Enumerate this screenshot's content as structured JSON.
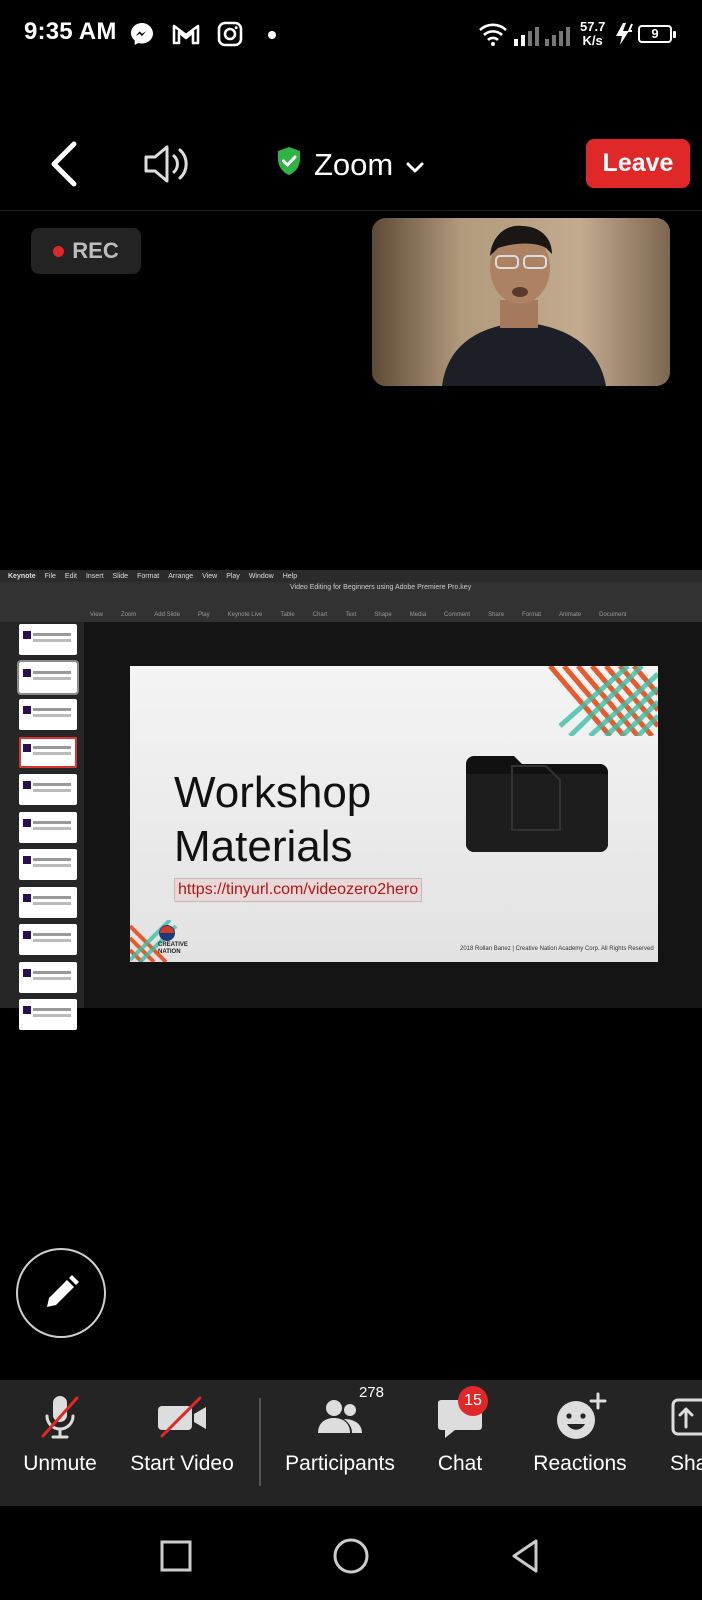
{
  "status_bar": {
    "time": "9:35 AM",
    "net_speed_value": "57.7",
    "net_speed_unit": "K/s",
    "battery": "9",
    "icons": [
      "messenger-icon",
      "gmail-icon",
      "instagram-icon",
      "wifi-icon",
      "signal-icon",
      "charging-icon"
    ]
  },
  "top_bar": {
    "title": "Zoom",
    "leave_label": "Leave"
  },
  "rec_label": "REC",
  "shared_screen": {
    "menubar_items": [
      "Keynote",
      "File",
      "Edit",
      "Insert",
      "Slide",
      "Format",
      "Arrange",
      "View",
      "Play",
      "Window",
      "Help"
    ],
    "document_title": "Video Editing for Beginners using Adobe Premiere Pro.key",
    "toolbar_items": [
      "View",
      "Zoom",
      "Add Slide",
      "Play",
      "Keynote Live",
      "Table",
      "Chart",
      "Text",
      "Shape",
      "Media",
      "Comment",
      "Share",
      "Format",
      "Animate",
      "Document"
    ],
    "slide": {
      "title_line1": "Workshop",
      "title_line2": "Materials",
      "link": "https://tinyurl.com/videozero2hero",
      "logo_line1": "CREATIVE",
      "logo_line2": "NATION",
      "footer": "2018 Rollan Banez | Creative Nation Academy Corp. All Rights Reserved"
    },
    "thumbnail_count": 11
  },
  "toolbar": {
    "unmute_label": "Unmute",
    "start_video_label": "Start Video",
    "participants_label": "Participants",
    "participants_count": "278",
    "chat_label": "Chat",
    "chat_badge": "15",
    "reactions_label": "Reactions",
    "share_label": "Sha"
  },
  "colors": {
    "leave_red": "#e02828",
    "shield_green": "#2fb344",
    "toolbar_bg": "#242424"
  }
}
